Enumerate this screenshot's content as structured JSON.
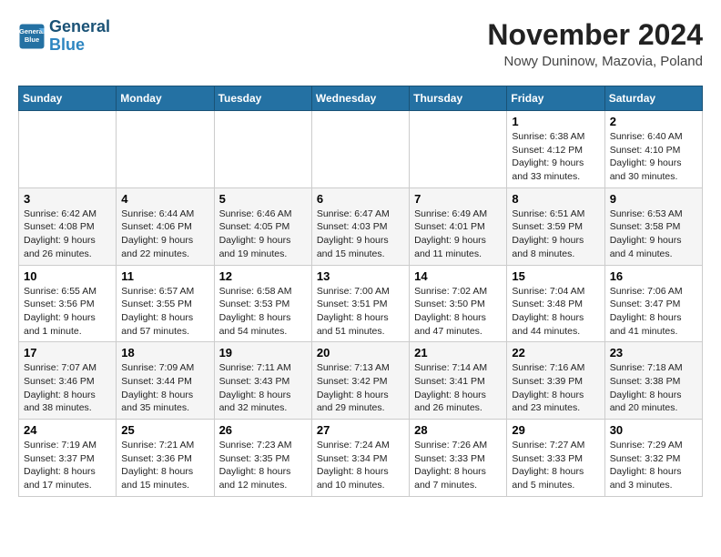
{
  "header": {
    "logo_line1": "General",
    "logo_line2": "Blue",
    "title": "November 2024",
    "subtitle": "Nowy Duninow, Mazovia, Poland"
  },
  "weekdays": [
    "Sunday",
    "Monday",
    "Tuesday",
    "Wednesday",
    "Thursday",
    "Friday",
    "Saturday"
  ],
  "weeks": [
    [
      {
        "num": "",
        "info": ""
      },
      {
        "num": "",
        "info": ""
      },
      {
        "num": "",
        "info": ""
      },
      {
        "num": "",
        "info": ""
      },
      {
        "num": "",
        "info": ""
      },
      {
        "num": "1",
        "info": "Sunrise: 6:38 AM\nSunset: 4:12 PM\nDaylight: 9 hours and 33 minutes."
      },
      {
        "num": "2",
        "info": "Sunrise: 6:40 AM\nSunset: 4:10 PM\nDaylight: 9 hours and 30 minutes."
      }
    ],
    [
      {
        "num": "3",
        "info": "Sunrise: 6:42 AM\nSunset: 4:08 PM\nDaylight: 9 hours and 26 minutes."
      },
      {
        "num": "4",
        "info": "Sunrise: 6:44 AM\nSunset: 4:06 PM\nDaylight: 9 hours and 22 minutes."
      },
      {
        "num": "5",
        "info": "Sunrise: 6:46 AM\nSunset: 4:05 PM\nDaylight: 9 hours and 19 minutes."
      },
      {
        "num": "6",
        "info": "Sunrise: 6:47 AM\nSunset: 4:03 PM\nDaylight: 9 hours and 15 minutes."
      },
      {
        "num": "7",
        "info": "Sunrise: 6:49 AM\nSunset: 4:01 PM\nDaylight: 9 hours and 11 minutes."
      },
      {
        "num": "8",
        "info": "Sunrise: 6:51 AM\nSunset: 3:59 PM\nDaylight: 9 hours and 8 minutes."
      },
      {
        "num": "9",
        "info": "Sunrise: 6:53 AM\nSunset: 3:58 PM\nDaylight: 9 hours and 4 minutes."
      }
    ],
    [
      {
        "num": "10",
        "info": "Sunrise: 6:55 AM\nSunset: 3:56 PM\nDaylight: 9 hours and 1 minute."
      },
      {
        "num": "11",
        "info": "Sunrise: 6:57 AM\nSunset: 3:55 PM\nDaylight: 8 hours and 57 minutes."
      },
      {
        "num": "12",
        "info": "Sunrise: 6:58 AM\nSunset: 3:53 PM\nDaylight: 8 hours and 54 minutes."
      },
      {
        "num": "13",
        "info": "Sunrise: 7:00 AM\nSunset: 3:51 PM\nDaylight: 8 hours and 51 minutes."
      },
      {
        "num": "14",
        "info": "Sunrise: 7:02 AM\nSunset: 3:50 PM\nDaylight: 8 hours and 47 minutes."
      },
      {
        "num": "15",
        "info": "Sunrise: 7:04 AM\nSunset: 3:48 PM\nDaylight: 8 hours and 44 minutes."
      },
      {
        "num": "16",
        "info": "Sunrise: 7:06 AM\nSunset: 3:47 PM\nDaylight: 8 hours and 41 minutes."
      }
    ],
    [
      {
        "num": "17",
        "info": "Sunrise: 7:07 AM\nSunset: 3:46 PM\nDaylight: 8 hours and 38 minutes."
      },
      {
        "num": "18",
        "info": "Sunrise: 7:09 AM\nSunset: 3:44 PM\nDaylight: 8 hours and 35 minutes."
      },
      {
        "num": "19",
        "info": "Sunrise: 7:11 AM\nSunset: 3:43 PM\nDaylight: 8 hours and 32 minutes."
      },
      {
        "num": "20",
        "info": "Sunrise: 7:13 AM\nSunset: 3:42 PM\nDaylight: 8 hours and 29 minutes."
      },
      {
        "num": "21",
        "info": "Sunrise: 7:14 AM\nSunset: 3:41 PM\nDaylight: 8 hours and 26 minutes."
      },
      {
        "num": "22",
        "info": "Sunrise: 7:16 AM\nSunset: 3:39 PM\nDaylight: 8 hours and 23 minutes."
      },
      {
        "num": "23",
        "info": "Sunrise: 7:18 AM\nSunset: 3:38 PM\nDaylight: 8 hours and 20 minutes."
      }
    ],
    [
      {
        "num": "24",
        "info": "Sunrise: 7:19 AM\nSunset: 3:37 PM\nDaylight: 8 hours and 17 minutes."
      },
      {
        "num": "25",
        "info": "Sunrise: 7:21 AM\nSunset: 3:36 PM\nDaylight: 8 hours and 15 minutes."
      },
      {
        "num": "26",
        "info": "Sunrise: 7:23 AM\nSunset: 3:35 PM\nDaylight: 8 hours and 12 minutes."
      },
      {
        "num": "27",
        "info": "Sunrise: 7:24 AM\nSunset: 3:34 PM\nDaylight: 8 hours and 10 minutes."
      },
      {
        "num": "28",
        "info": "Sunrise: 7:26 AM\nSunset: 3:33 PM\nDaylight: 8 hours and 7 minutes."
      },
      {
        "num": "29",
        "info": "Sunrise: 7:27 AM\nSunset: 3:33 PM\nDaylight: 8 hours and 5 minutes."
      },
      {
        "num": "30",
        "info": "Sunrise: 7:29 AM\nSunset: 3:32 PM\nDaylight: 8 hours and 3 minutes."
      }
    ]
  ]
}
